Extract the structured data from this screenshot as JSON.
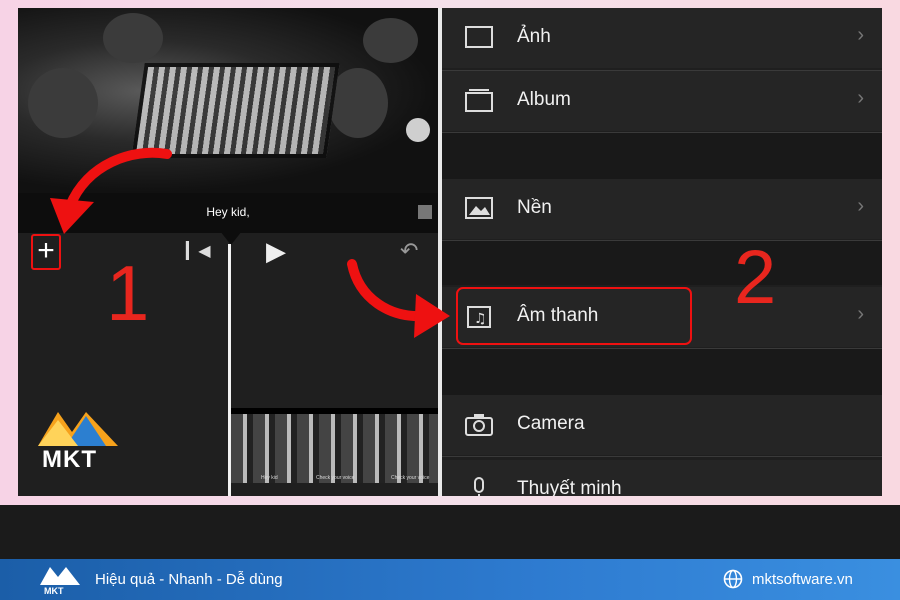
{
  "left_panel": {
    "caption": "Hey kid,",
    "add_button_label": "+",
    "step_number": "1",
    "clip_labels": [
      "Hey kid",
      "Check your voice",
      "Check your voice"
    ]
  },
  "right_panel": {
    "menu_items": [
      {
        "label": "Ảnh",
        "icon": "photo-icon"
      },
      {
        "label": "Album",
        "icon": "album-icon"
      },
      {
        "label": "Nền",
        "icon": "background-icon"
      },
      {
        "label": "Âm thanh",
        "icon": "music-icon"
      },
      {
        "label": "Camera",
        "icon": "camera-icon"
      },
      {
        "label": "Thuyết minh",
        "icon": "microphone-icon"
      }
    ],
    "step_number": "2"
  },
  "logo": {
    "text": "MKT"
  },
  "footer": {
    "tagline": "Hiệu quả - Nhanh - Dễ dùng",
    "website": "mktsoftware.vn"
  },
  "colors": {
    "accent_red": "#e8261e",
    "footer_blue": "#2e7bd0"
  }
}
